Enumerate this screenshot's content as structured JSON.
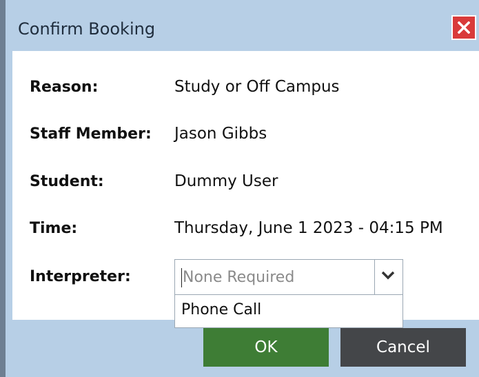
{
  "dialog": {
    "title": "Confirm Booking",
    "close_icon": "close-icon"
  },
  "fields": [
    {
      "label": "Reason:",
      "value": "Study or Off Campus"
    },
    {
      "label": "Staff Member:",
      "value": "Jason Gibbs"
    },
    {
      "label": "Student:",
      "value": "Dummy User"
    },
    {
      "label": "Time:",
      "value": "Thursday, June 1 2023 - 04:15 PM"
    }
  ],
  "interpreter": {
    "label": "Interpreter:",
    "placeholder": "None Required",
    "dropdown_icon": "chevron-down-icon",
    "options": [
      "Phone Call"
    ]
  },
  "buttons": {
    "ok": "OK",
    "cancel": "Cancel"
  },
  "colors": {
    "frame": "#b7cfe6",
    "ok": "#3e7d35",
    "cancel": "#444649",
    "close": "#d93a3a"
  }
}
